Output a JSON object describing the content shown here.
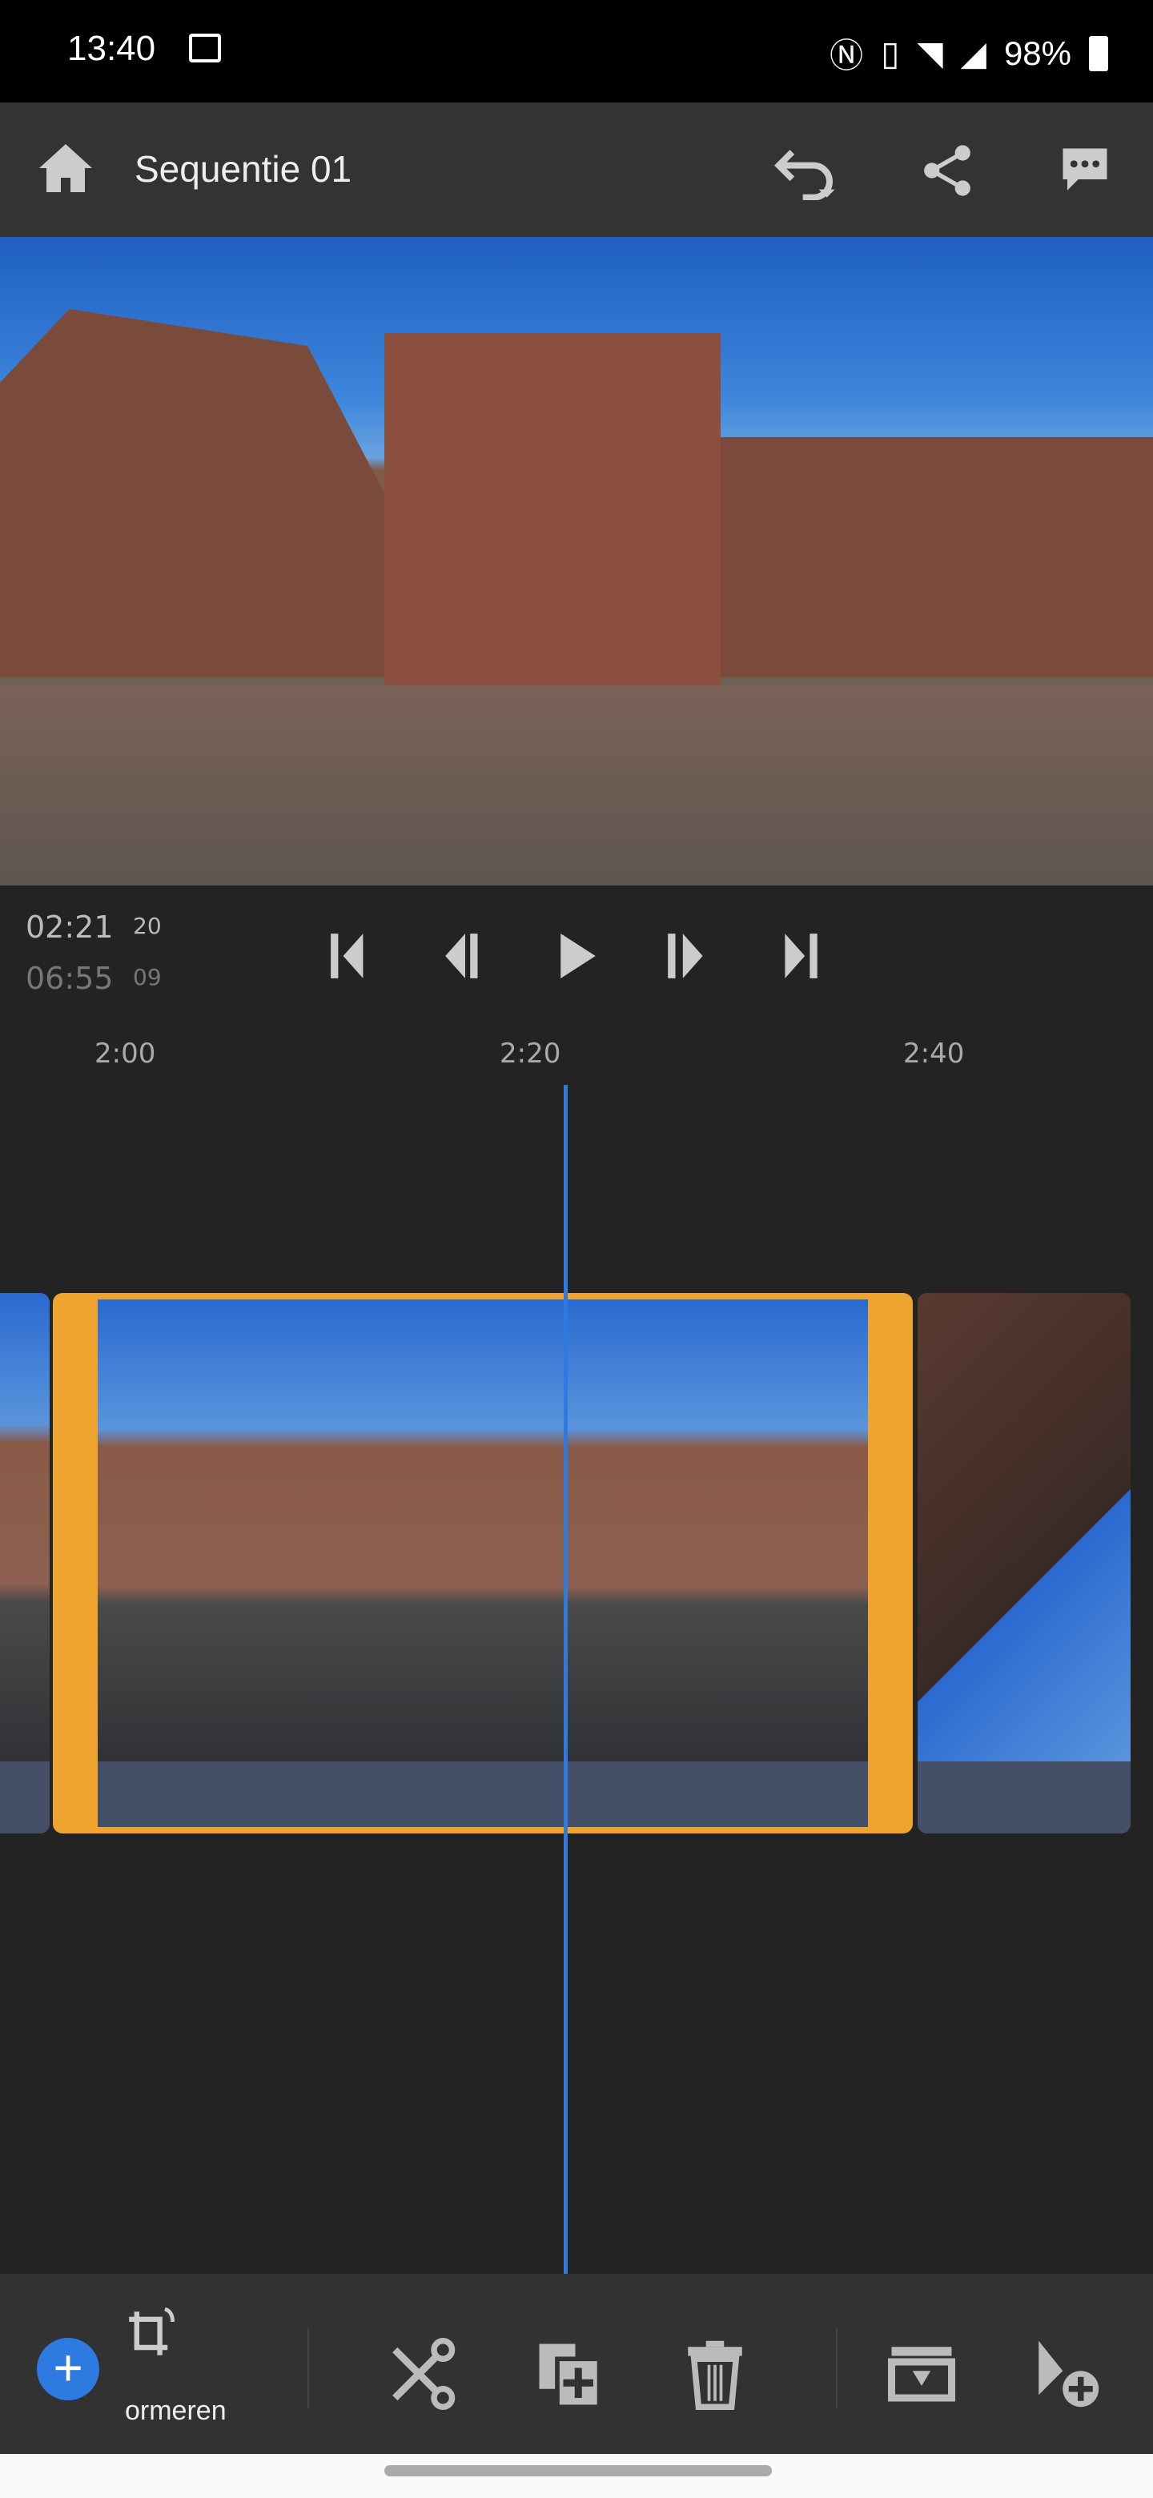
{
  "status_bar": {
    "time": "13:40",
    "battery": "98%"
  },
  "header": {
    "title": "Sequentie 01"
  },
  "playback": {
    "current_time": "02:21",
    "current_frames": "20",
    "duration": "06:55",
    "duration_frames": "09"
  },
  "timeline": {
    "ruler_labels": [
      "2:00",
      "2:20",
      "2:40"
    ],
    "selected_color": "#f0a430",
    "playhead_color": "#2d7be0"
  },
  "toolbar": {
    "transform_label": "ormeren"
  }
}
